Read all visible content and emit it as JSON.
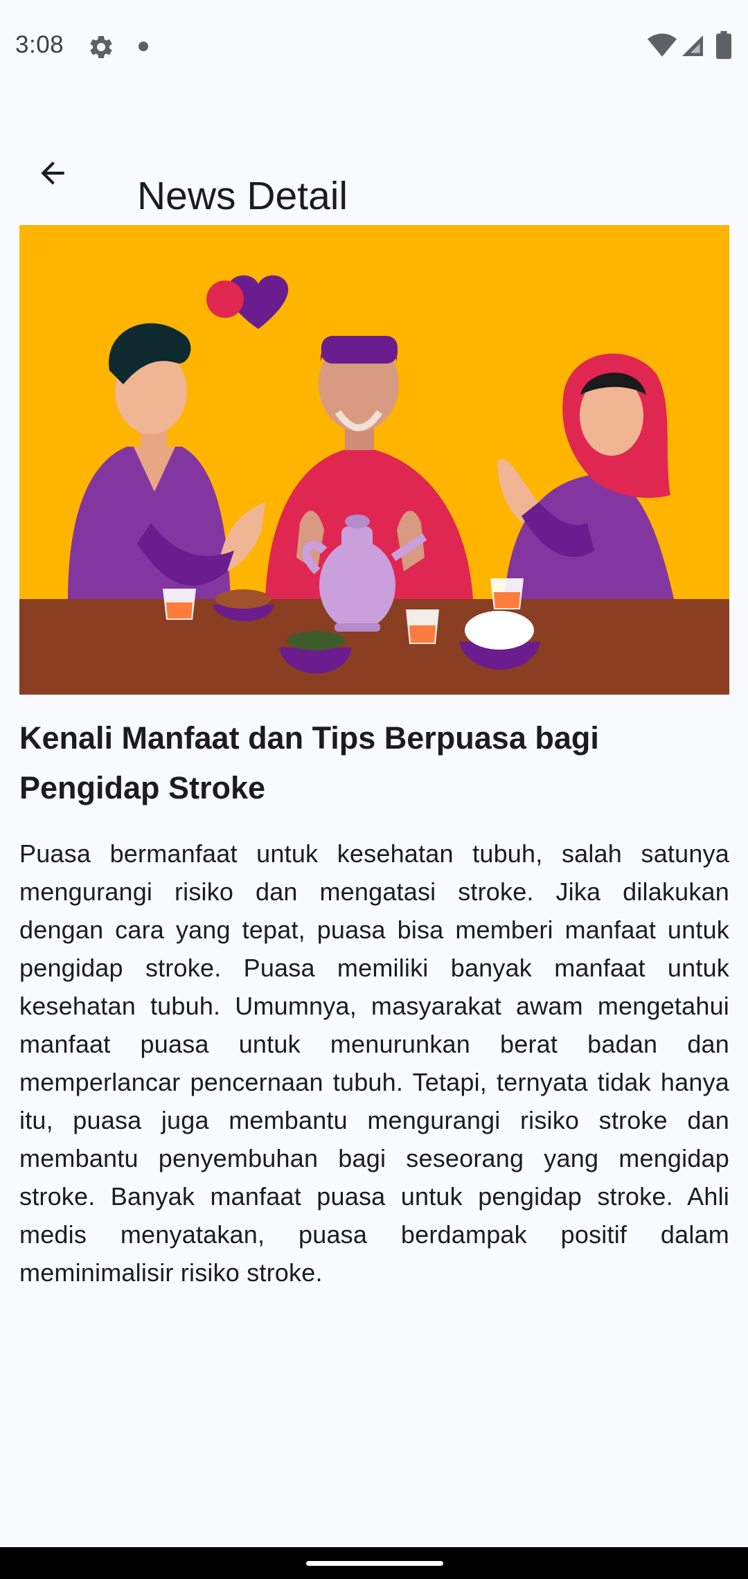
{
  "status_bar": {
    "time": "3:08",
    "icons": [
      "settings-gear-icon",
      "notification-dot-icon",
      "wifi-icon",
      "cell-signal-icon",
      "battery-icon"
    ]
  },
  "app_bar": {
    "back_icon": "arrow-back-icon",
    "title": "News Detail"
  },
  "hero_image": {
    "description_icon": "family-iftar-illustration",
    "colors": {
      "background": "#FFB400",
      "table": "#8A3E22",
      "purple": "#8436A0",
      "magenta": "#E02752"
    }
  },
  "article": {
    "title": "Kenali Manfaat dan Tips Berpuasa bagi Pengidap Stroke",
    "body": "Puasa bermanfaat untuk kesehatan tubuh, salah satunya mengurangi risiko dan mengatasi stroke. Jika dilakukan dengan cara yang tepat, puasa bisa memberi manfaat untuk pengidap stroke. Puasa memiliki banyak manfaat untuk kesehatan tubuh. Umumnya, masyarakat awam mengetahui manfaat puasa untuk menurunkan berat badan dan memperlancar pencernaan tubuh. Tetapi, ternyata tidak hanya itu, puasa juga membantu mengurangi risiko stroke dan membantu penyembuhan bagi seseorang yang mengidap stroke. Banyak manfaat puasa untuk pengidap stroke. Ahli medis menyatakan, puasa berdampak positif dalam meminimalisir risiko stroke."
  }
}
